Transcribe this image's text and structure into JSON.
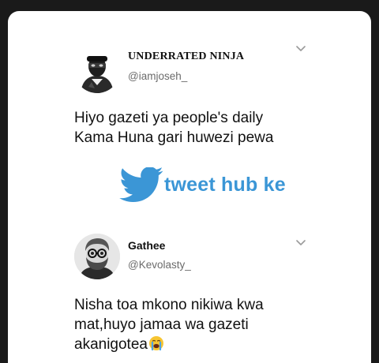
{
  "tweets": [
    {
      "display_name": "UNDERRATED NINJA",
      "handle": "@iamjoseh_",
      "text_lines": [
        "Hiyo gazeti ya people's daily",
        "Kama Huna gari huwezi pewa"
      ]
    },
    {
      "display_name": "Gathee",
      "handle": "@Kevolasty_",
      "text_lines": [
        "Nisha toa mkono nikiwa kwa",
        "mat,huyo jamaa wa gazeti",
        "akanigotea"
      ]
    }
  ],
  "watermark": {
    "text": "tweet hub ke",
    "icon": "bird-icon"
  },
  "icons": {
    "menu_chevron": "chevron-down-icon",
    "crying_emoji": "crying-face-icon"
  },
  "colors": {
    "background": "#ffffff",
    "text": "#111111",
    "muted": "#6b6b6b",
    "watermark": "#3b96d6"
  }
}
